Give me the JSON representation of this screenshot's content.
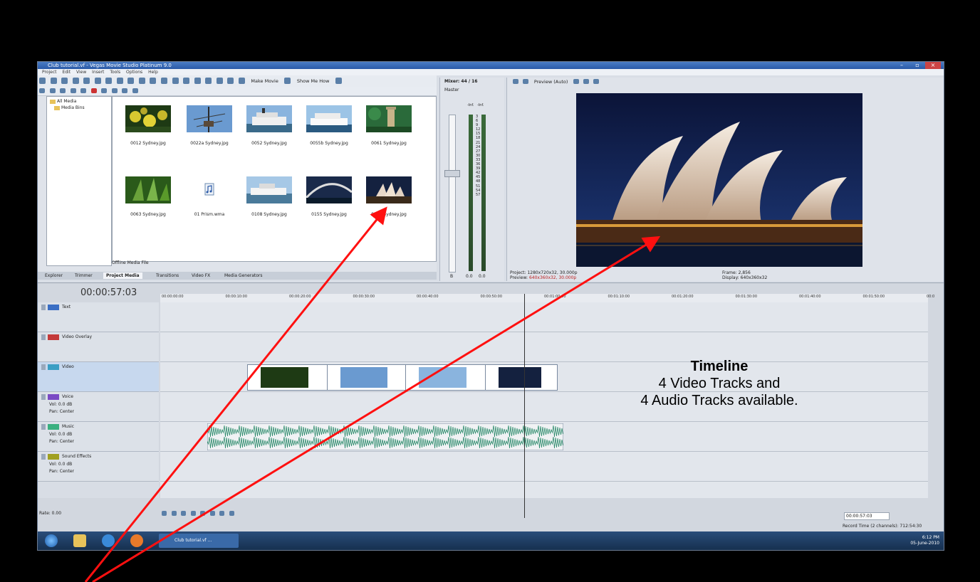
{
  "window": {
    "title": "Club tutorial.vf - Vegas Movie Studio Platinum 9.0",
    "menu": [
      "Project",
      "Edit",
      "View",
      "Insert",
      "Tools",
      "Options",
      "Help"
    ]
  },
  "toolbar": {
    "make_movie": "Make Movie",
    "show_me_how": "Show Me How"
  },
  "media": {
    "tree": [
      "All Media",
      "Media Bins"
    ],
    "files": [
      "0012 Sydney.jpg",
      "0022a Sydney.jpg",
      "0052 Sydney.jpg",
      "0055b Sydney.jpg",
      "0061 Sydney.jpg",
      "0063 Sydney.jpg",
      "01 Prism.wma",
      "0108 Sydney.jpg",
      "0155 Sydney.jpg",
      "0156 Sydney.jpg"
    ],
    "status": "Offline Media File",
    "tabs": [
      "Explorer",
      "Trimmer",
      "Project Media",
      "Transitions",
      "Video FX",
      "Media Generators"
    ],
    "active_tab": "Project Media"
  },
  "mixer": {
    "title": "Mixer: 44 / 16",
    "master": "Master",
    "peak_left": "-Inf.",
    "peak_right": "-Inf.",
    "scale": [
      "3",
      "6",
      "9",
      "12",
      "15",
      "18",
      "21",
      "24",
      "27",
      "30",
      "33",
      "36",
      "39",
      "42",
      "45",
      "48",
      "51",
      "54",
      "57"
    ],
    "footer_left": "B",
    "footer_mid": "0.0",
    "footer_right": "0.0"
  },
  "preview": {
    "mode": "Preview (Auto)",
    "project_label": "Project:",
    "project_value": "1280x720x32, 30.000p",
    "preview_label": "Preview:",
    "preview_value": "640x360x32, 30.000p",
    "frame_label": "Frame:",
    "frame_value": "2,856",
    "display_label": "Display:",
    "display_value": "640x360x32"
  },
  "timeline": {
    "timecode": "00:00:57:03",
    "ruler": [
      "00:00:00:00",
      "00:00:10:00",
      "00:00:20:00",
      "00:00:30:00",
      "00:00:40:00",
      "00:00:50:00",
      "00:01:00:00",
      "00:01:10:00",
      "00:01:20:00",
      "00:01:30:00",
      "00:01:40:00",
      "00:01:50:00",
      "00:0"
    ],
    "tracks": [
      {
        "name": "Text",
        "color": "#3a6ec4"
      },
      {
        "name": "Video Overlay",
        "color": "#c43a3a"
      },
      {
        "name": "Video",
        "color": "#3a9ec4"
      },
      {
        "name": "Voice",
        "color": "#7a4ac4"
      },
      {
        "name": "Music",
        "color": "#3ab080"
      },
      {
        "name": "Sound Effects",
        "color": "#a0a020"
      }
    ],
    "vol_label": "Vol:",
    "vol_value": "0.0 dB",
    "pan_label": "Pan:",
    "pan_value": "Center",
    "rate": "Rate: 0.00",
    "end_timecode": "00:00:57:03",
    "record_time": "Record Time (2 channels): 712:54:30"
  },
  "taskbar": {
    "app_item": "Club tutorial.vf ...",
    "time": "6:12 PM",
    "date": "05-June-2010"
  },
  "callout": {
    "heading": "Timeline",
    "line1": "4 Video Tracks and",
    "line2": "4 Audio Tracks available."
  }
}
